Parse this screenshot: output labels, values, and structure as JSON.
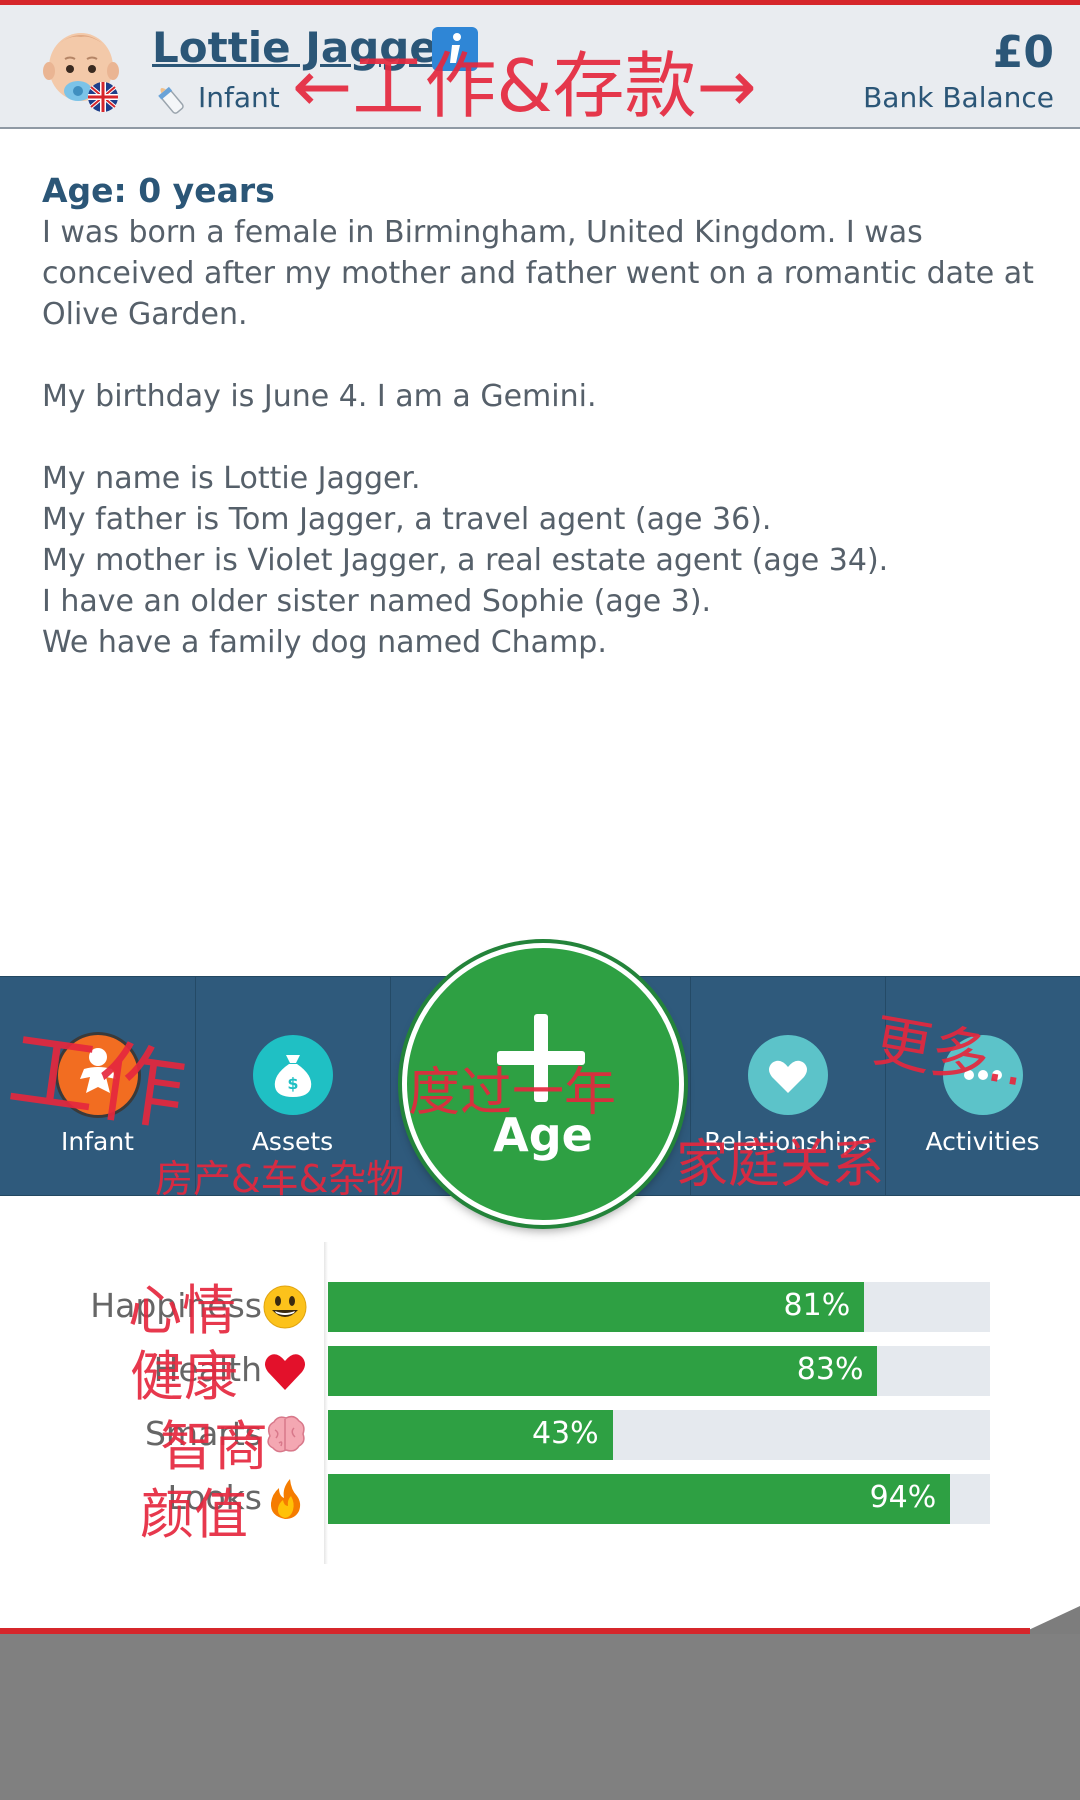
{
  "header": {
    "name": "Lottie Jagger",
    "life_stage": "Infant",
    "bank_balance": "£0",
    "bank_balance_label": "Bank Balance",
    "annotation": "←工作&存款→"
  },
  "bio": {
    "age_title": "Age: 0 years",
    "paragraphs": [
      [
        "I was born a female in Birmingham, United Kingdom. I was",
        "conceived after my mother and father went on a romantic date at",
        "Olive Garden."
      ],
      [
        "My birthday is June 4. I am a Gemini."
      ],
      [
        "My name is Lottie Jagger.",
        "My father is Tom Jagger, a travel agent (age 36).",
        "My mother is Violet Jagger, a real estate agent (age 34).",
        "I have an older sister named Sophie (age 3).",
        "We have a family dog named Champ."
      ]
    ]
  },
  "nav": {
    "items": [
      {
        "label": "Infant",
        "icon": "baby-icon",
        "color": "#f26d21"
      },
      {
        "label": "Assets",
        "icon": "money-bag-icon",
        "color": "#1fc0c4"
      },
      {
        "label": "Relationships",
        "icon": "heart-icon",
        "color": "#5cc3c9"
      },
      {
        "label": "Activities",
        "icon": "more-dots-icon",
        "color": "#5cc3c9"
      }
    ],
    "age_button": {
      "label": "Age",
      "icon": "plus-icon",
      "color": "#2ea043"
    },
    "annotations": {
      "work": "工作",
      "assets": "房产&车&杂物",
      "age_year": "度过一年",
      "family": "家庭关系",
      "more": "更多.."
    }
  },
  "stats": [
    {
      "label": "Happiness",
      "value": 81,
      "display": "81%",
      "emoji": "grinning-face-icon",
      "annotation": "心情"
    },
    {
      "label": "Health",
      "value": 83,
      "display": "83%",
      "emoji": "red-heart-icon",
      "annotation": "健康"
    },
    {
      "label": "Smarts",
      "value": 43,
      "display": "43%",
      "emoji": "brain-icon",
      "annotation": "智商"
    },
    {
      "label": "Looks",
      "value": 94,
      "display": "94%",
      "emoji": "fire-icon",
      "annotation": "颜值"
    }
  ],
  "colors": {
    "accent_red": "#d6262b",
    "header_text": "#2b5677",
    "bar_fill": "#2ea043",
    "bar_track": "#e5e9ee",
    "nav_bg": "#2f5a7c"
  }
}
